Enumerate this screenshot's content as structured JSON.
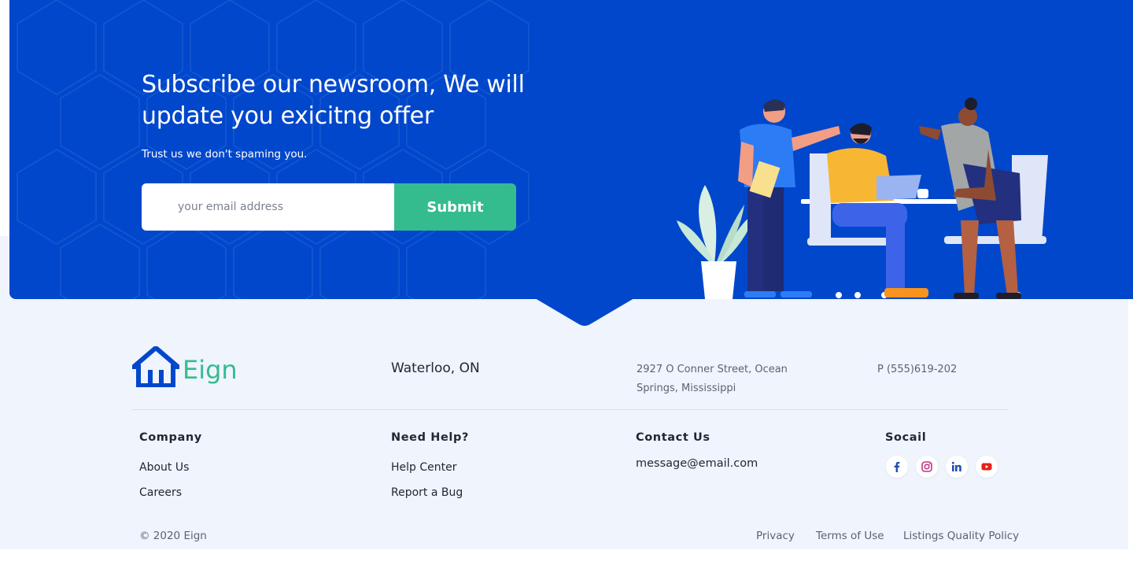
{
  "newsletter": {
    "title": "Subscribe our newsroom, We will update you exicitng offer",
    "subtitle": "Trust us we don't spaming you.",
    "email_placeholder": "your email address",
    "submit_label": "Submit"
  },
  "colors": {
    "hero_blue": "#0047cc",
    "accent_green": "#34bc8f",
    "footer_bg": "#eff4fd"
  },
  "footer": {
    "brand": "Eign",
    "city": "Waterloo, ON",
    "address": "2927  O Conner Street, Ocean Springs, Mississippi",
    "phone": "P (555)619-202",
    "company": {
      "heading": "Company",
      "links": [
        "About Us",
        "Careers"
      ]
    },
    "help": {
      "heading": "Need Help?",
      "links": [
        "Help Center",
        "Report a Bug"
      ]
    },
    "contact": {
      "heading": "Contact Us",
      "email": "message@email.com"
    },
    "social": {
      "heading": "Socail",
      "icons": [
        "facebook-icon",
        "instagram-icon",
        "linkedin-icon",
        "youtube-icon"
      ]
    },
    "copyright": "© 2020 Eign",
    "legal_links": [
      "Privacy",
      "Terms of Use",
      "Listings Quality Policy"
    ]
  }
}
